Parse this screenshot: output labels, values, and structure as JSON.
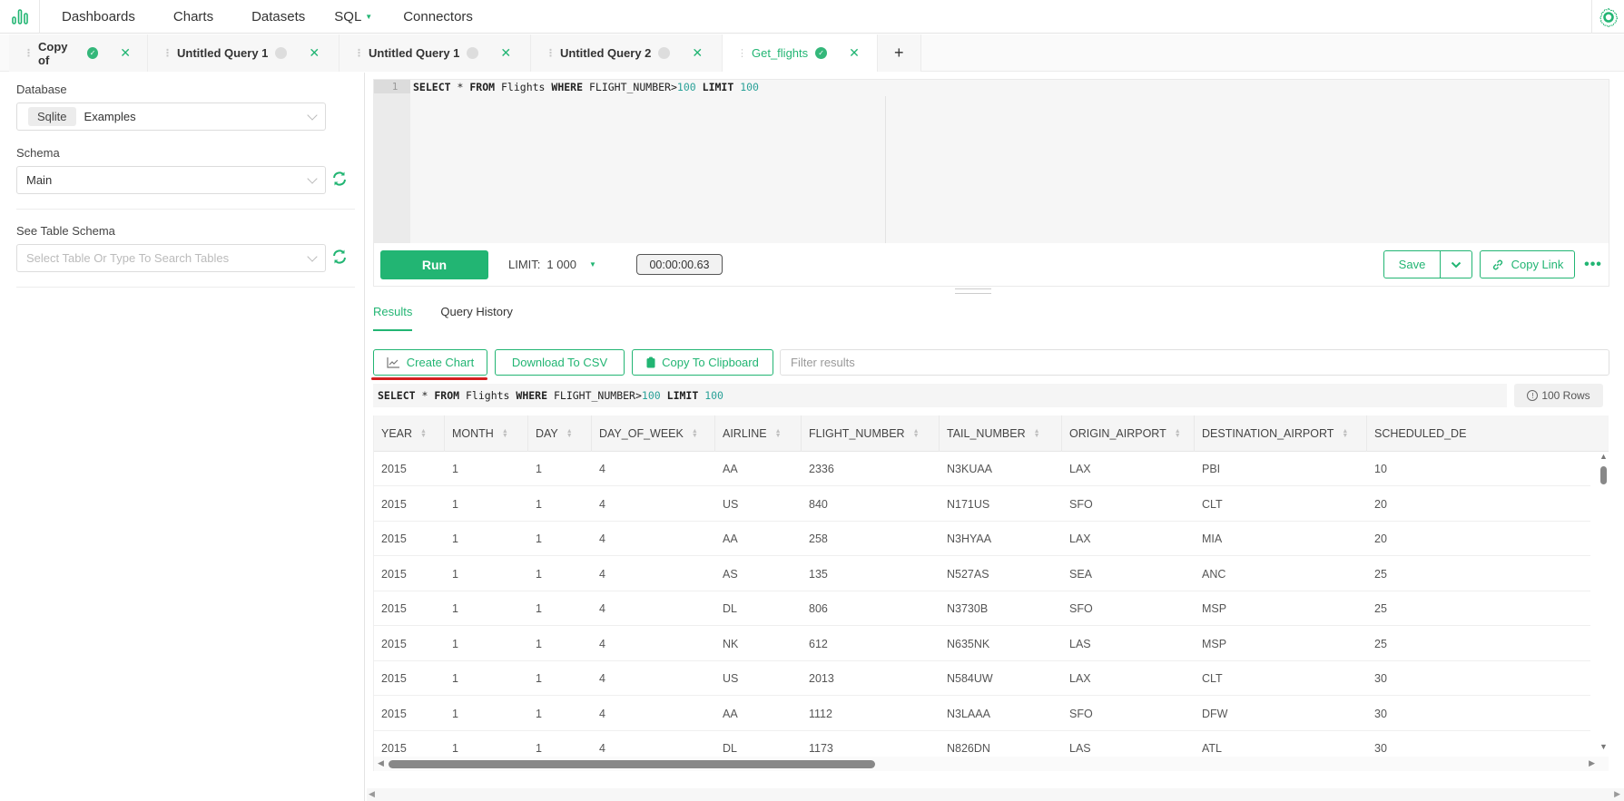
{
  "nav": {
    "items": [
      "Dashboards",
      "Charts",
      "Datasets",
      "SQL",
      "Connectors"
    ],
    "sql_has_dropdown": true,
    "accent_color": "#22b573"
  },
  "tabs": [
    {
      "label": "Copy of",
      "status": "success",
      "active": false
    },
    {
      "label": "Untitled Query 1",
      "status": "idle",
      "active": false
    },
    {
      "label": "Untitled Query 1",
      "status": "idle",
      "active": false
    },
    {
      "label": "Untitled Query 2",
      "status": "idle",
      "active": false
    },
    {
      "label": "Get_flights",
      "status": "success",
      "active": true
    }
  ],
  "tab_add_label": "+",
  "left": {
    "database_label": "Database",
    "database_tag": "Sqlite",
    "database_value": "Examples",
    "schema_label": "Schema",
    "schema_value": "Main",
    "table_schema_label": "See Table Schema",
    "table_placeholder": "Select Table Or Type To Search Tables"
  },
  "editor": {
    "line_number": "1",
    "query": "SELECT * FROM Flights WHERE FLIGHT_NUMBER>100 LIMIT 100"
  },
  "toolbar": {
    "run_label": "Run",
    "limit_label": "LIMIT:",
    "limit_value": "1 000",
    "timer": "00:00:00.63",
    "save_label": "Save",
    "copy_link_label": "Copy Link",
    "more_label": "•••"
  },
  "results": {
    "tabs": [
      "Results",
      "Query History"
    ],
    "active_tab": "Results",
    "create_chart_label": "Create Chart",
    "download_csv_label": "Download To CSV",
    "copy_clipboard_label": "Copy To Clipboard",
    "filter_placeholder": "Filter results",
    "executed_query": "SELECT * FROM Flights WHERE FLIGHT_NUMBER>100 LIMIT 100",
    "row_count": "100 Rows",
    "columns": [
      "YEAR",
      "MONTH",
      "DAY",
      "DAY_OF_WEEK",
      "AIRLINE",
      "FLIGHT_NUMBER",
      "TAIL_NUMBER",
      "ORIGIN_AIRPORT",
      "DESTINATION_AIRPORT",
      "SCHEDULED_DE"
    ],
    "rows": [
      [
        "2015",
        "1",
        "1",
        "4",
        "AA",
        "2336",
        "N3KUAA",
        "LAX",
        "PBI",
        "10"
      ],
      [
        "2015",
        "1",
        "1",
        "4",
        "US",
        "840",
        "N171US",
        "SFO",
        "CLT",
        "20"
      ],
      [
        "2015",
        "1",
        "1",
        "4",
        "AA",
        "258",
        "N3HYAA",
        "LAX",
        "MIA",
        "20"
      ],
      [
        "2015",
        "1",
        "1",
        "4",
        "AS",
        "135",
        "N527AS",
        "SEA",
        "ANC",
        "25"
      ],
      [
        "2015",
        "1",
        "1",
        "4",
        "DL",
        "806",
        "N3730B",
        "SFO",
        "MSP",
        "25"
      ],
      [
        "2015",
        "1",
        "1",
        "4",
        "NK",
        "612",
        "N635NK",
        "LAS",
        "MSP",
        "25"
      ],
      [
        "2015",
        "1",
        "1",
        "4",
        "US",
        "2013",
        "N584UW",
        "LAX",
        "CLT",
        "30"
      ],
      [
        "2015",
        "1",
        "1",
        "4",
        "AA",
        "1112",
        "N3LAAA",
        "SFO",
        "DFW",
        "30"
      ],
      [
        "2015",
        "1",
        "1",
        "4",
        "DL",
        "1173",
        "N826DN",
        "LAS",
        "ATL",
        "30"
      ]
    ]
  }
}
